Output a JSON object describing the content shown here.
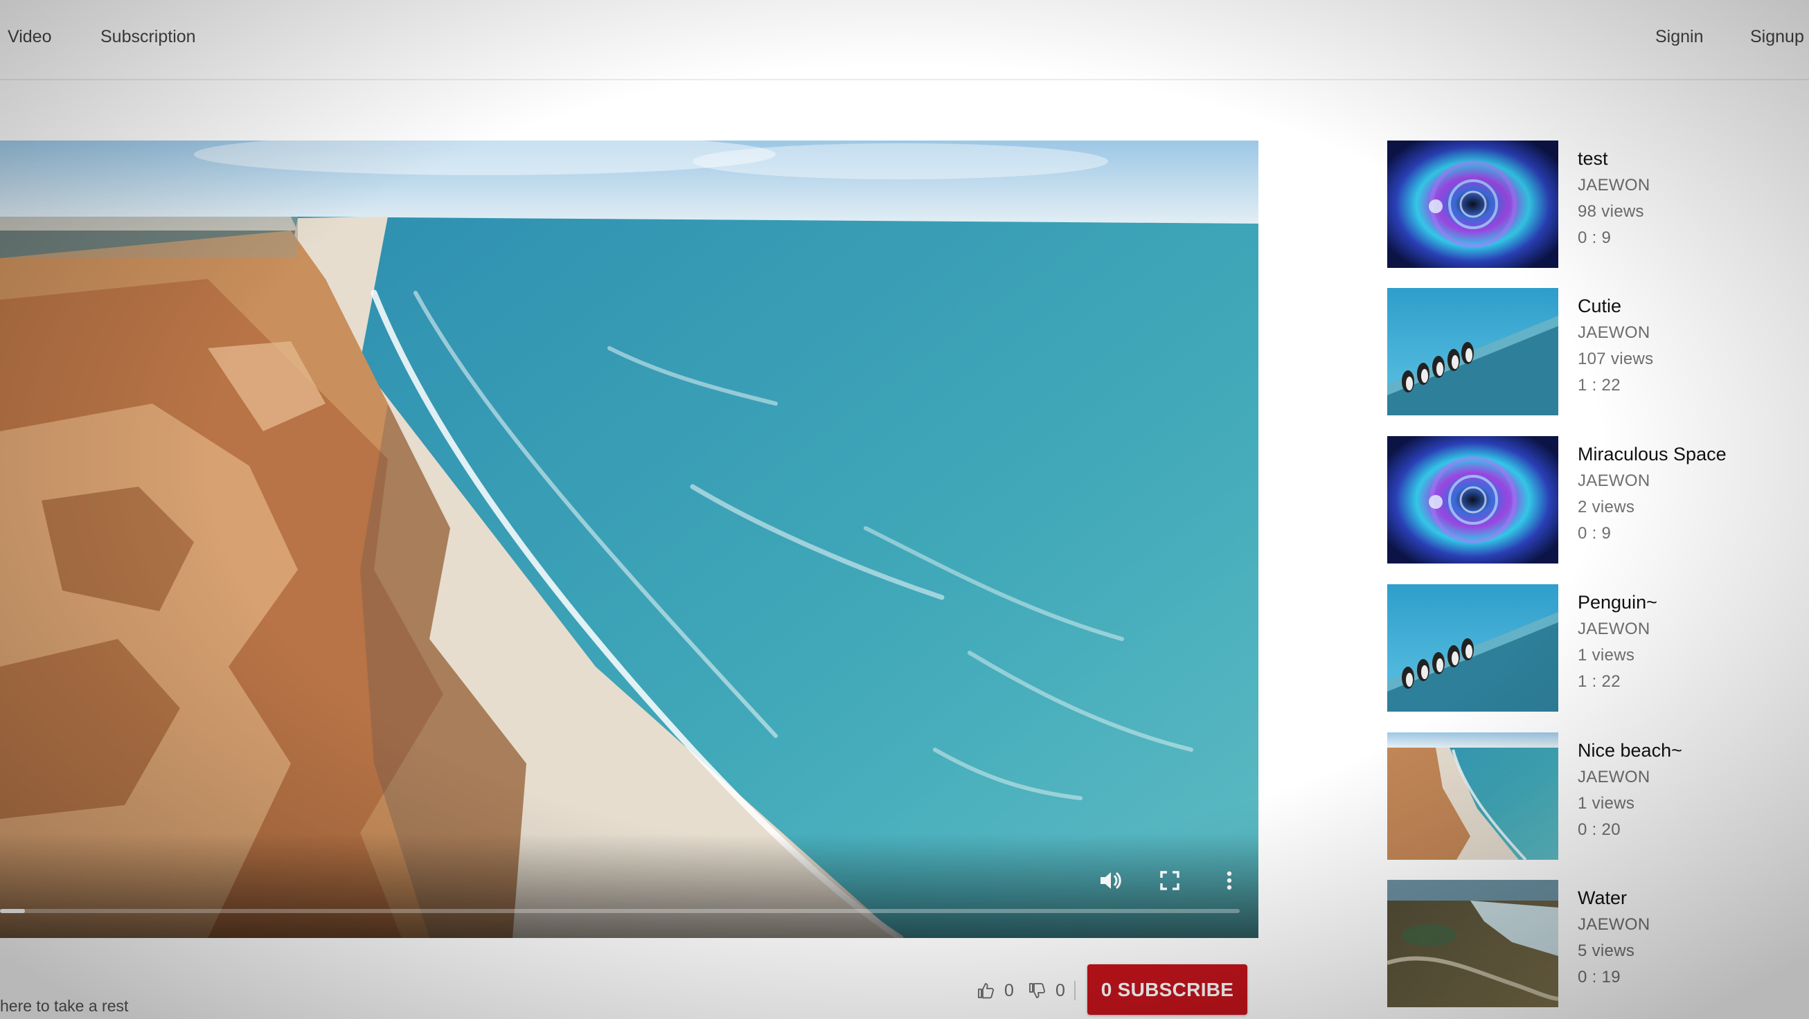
{
  "nav": {
    "video_label": "Video",
    "subscription_label": "Subscription",
    "signin_label": "Signin",
    "signup_label": "Signup"
  },
  "player": {
    "progress_fraction": 0.02,
    "icons": [
      "volume-icon",
      "fullscreen-icon",
      "more-options-icon"
    ]
  },
  "video": {
    "description_fragment": "here to take a rest",
    "likes": "0",
    "dislikes": "0",
    "subscribe_label": "0 SUBSCRIBE"
  },
  "sidebar": {
    "items": [
      {
        "title": "test",
        "author": "JAEWON",
        "views": "98 views",
        "duration": "0 : 9",
        "thumb": "space"
      },
      {
        "title": "Cutie",
        "author": "JAEWON",
        "views": "107 views",
        "duration": "1 : 22",
        "thumb": "penguin"
      },
      {
        "title": "Miraculous Space",
        "author": "JAEWON",
        "views": "2 views",
        "duration": "0 : 9",
        "thumb": "space"
      },
      {
        "title": "Penguin~",
        "author": "JAEWON",
        "views": "1 views",
        "duration": "1 : 22",
        "thumb": "penguin"
      },
      {
        "title": "Nice beach~",
        "author": "JAEWON",
        "views": "1 views",
        "duration": "0 : 20",
        "thumb": "beach"
      },
      {
        "title": "Water",
        "author": "JAEWON",
        "views": "5 views",
        "duration": "0 : 19",
        "thumb": "water"
      }
    ]
  },
  "colors": {
    "subscribe_red": "#c4141c",
    "sea_blue": "#3fa3b5"
  }
}
